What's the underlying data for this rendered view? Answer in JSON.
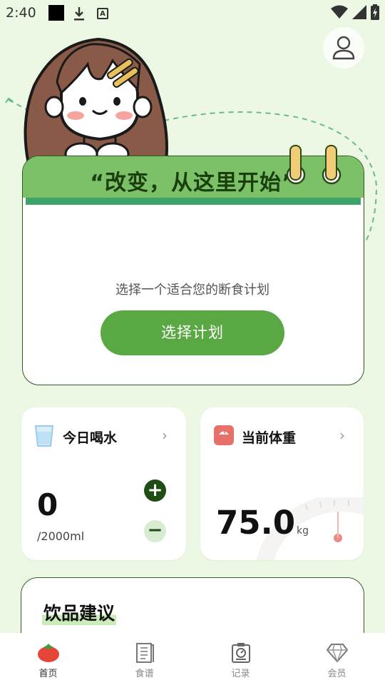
{
  "status_bar": {
    "time": "2:40"
  },
  "plan_card": {
    "title": "“改变，从这里开始”",
    "description": "选择一个适合您的断食计划",
    "button_label": "选择计划"
  },
  "water_card": {
    "title": "今日喝水",
    "value": "0",
    "goal": "/2000ml"
  },
  "weight_card": {
    "title": "当前体重",
    "value": "75.0",
    "unit": "kg"
  },
  "drinks_card": {
    "title": "饮品建议"
  },
  "bottom_nav": {
    "items": [
      {
        "label": "首页",
        "icon": "tomato-icon",
        "active": true
      },
      {
        "label": "食谱",
        "icon": "recipe-book-icon",
        "active": false
      },
      {
        "label": "记录",
        "icon": "scale-record-icon",
        "active": false
      },
      {
        "label": "会员",
        "icon": "diamond-icon",
        "active": false
      }
    ]
  },
  "colors": {
    "background": "#ecf8e4",
    "primary_green": "#5aa844",
    "header_green": "#7cc067",
    "dark_green": "#1f4d14"
  }
}
